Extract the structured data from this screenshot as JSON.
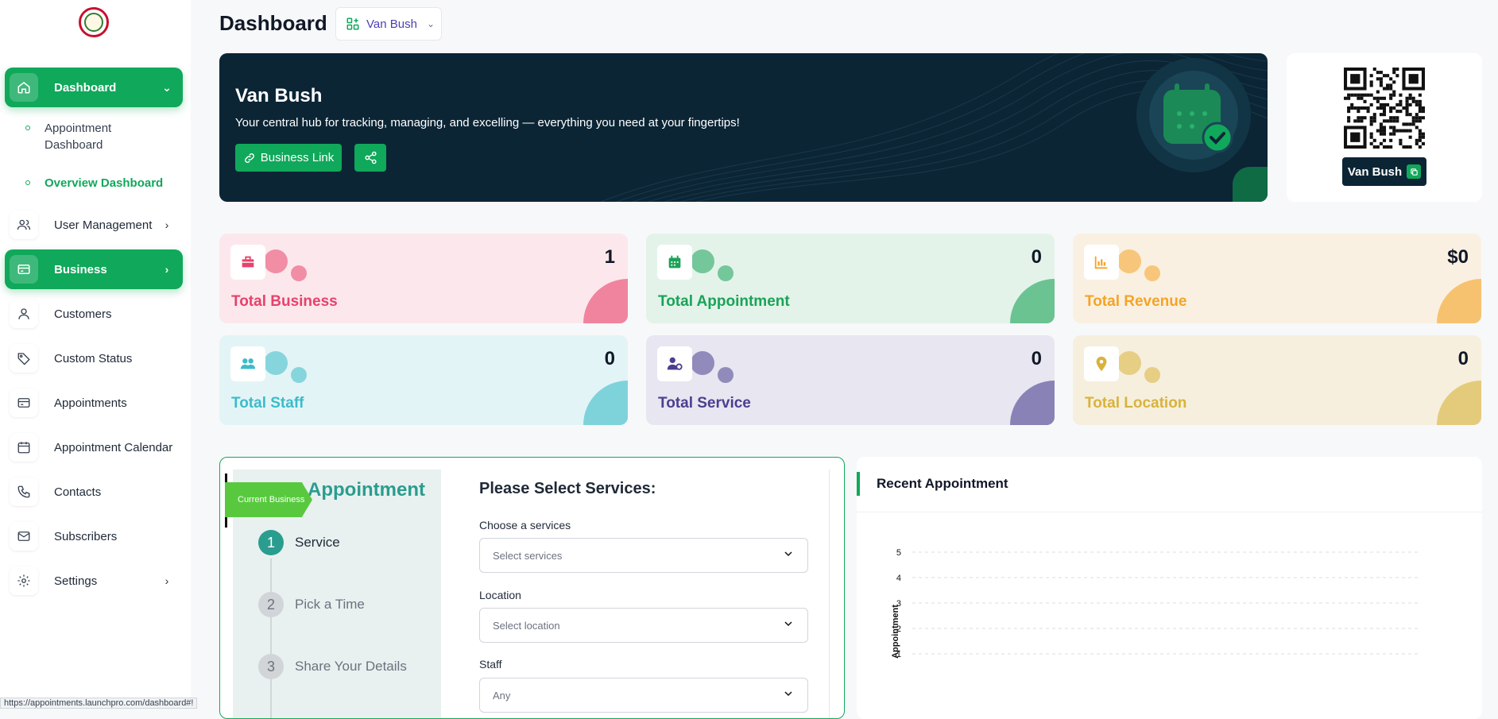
{
  "sidebar": {
    "items": [
      {
        "label": "Dashboard",
        "icon": "home-icon",
        "active": true
      },
      {
        "label": "User Management",
        "icon": "users-icon"
      },
      {
        "label": "Business",
        "icon": "card-icon",
        "active": true
      },
      {
        "label": "Customers",
        "icon": "user-icon"
      },
      {
        "label": "Custom Status",
        "icon": "tag-icon"
      },
      {
        "label": "Appointments",
        "icon": "card-icon"
      },
      {
        "label": "Appointment Calendar",
        "icon": "calendar-icon"
      },
      {
        "label": "Contacts",
        "icon": "phone-icon"
      },
      {
        "label": "Subscribers",
        "icon": "mail-icon"
      },
      {
        "label": "Settings",
        "icon": "gear-icon"
      }
    ],
    "sub_items": [
      {
        "label_line1": "Appointment",
        "label_line2": "Dashboard"
      },
      {
        "label": "Overview Dashboard",
        "active": true
      }
    ]
  },
  "header": {
    "title": "Dashboard",
    "business_selector": "Van Bush"
  },
  "hero": {
    "title": "Van Bush",
    "subtitle": "Your central hub for tracking, managing, and excelling — everything you need at your fingertips!",
    "business_link_label": "Business Link"
  },
  "qr": {
    "label": "Van Bush"
  },
  "stats": [
    {
      "label": "Total Business",
      "value": "1",
      "color": "#e8416b",
      "bg": "#fce8ec",
      "icon": "briefcase-icon"
    },
    {
      "label": "Total Appointment",
      "value": "0",
      "color": "#1aa357",
      "bg": "#e3f3ea",
      "icon": "calendar-icon"
    },
    {
      "label": "Total Revenue",
      "value": "$0",
      "color": "#f5a425",
      "bg": "#faf0e2",
      "icon": "bar-chart-icon"
    },
    {
      "label": "Total Staff",
      "value": "0",
      "color": "#3bbcc9",
      "bg": "#e3f4f6",
      "icon": "users-icon"
    },
    {
      "label": "Total Service",
      "value": "0",
      "color": "#4b3f8f",
      "bg": "#e7e6f1",
      "icon": "user-gear-icon"
    },
    {
      "label": "Total Location",
      "value": "0",
      "color": "#d8b33c",
      "bg": "#f6efdd",
      "icon": "map-pin-icon"
    }
  ],
  "booking": {
    "heading": "Appointment",
    "ribbon": "Current Business",
    "steps": [
      {
        "num": "1",
        "label": "Service",
        "active": true
      },
      {
        "num": "2",
        "label": "Pick a Time"
      },
      {
        "num": "3",
        "label": "Share Your Details"
      }
    ],
    "form_title": "Please Select Services:",
    "fields": [
      {
        "label": "Choose a services",
        "placeholder": "Select services"
      },
      {
        "label": "Location",
        "placeholder": "Select location"
      },
      {
        "label": "Staff",
        "placeholder": "Any"
      }
    ]
  },
  "recent": {
    "title": "Recent Appointment"
  },
  "chart_data": {
    "type": "line",
    "ylabel": "Appointment",
    "ylim": [
      0,
      5
    ],
    "yticks": [
      "5",
      "4",
      "3",
      "2",
      "1"
    ],
    "grid": true
  },
  "status_bar": "https://appointments.launchpro.com/dashboard#!"
}
